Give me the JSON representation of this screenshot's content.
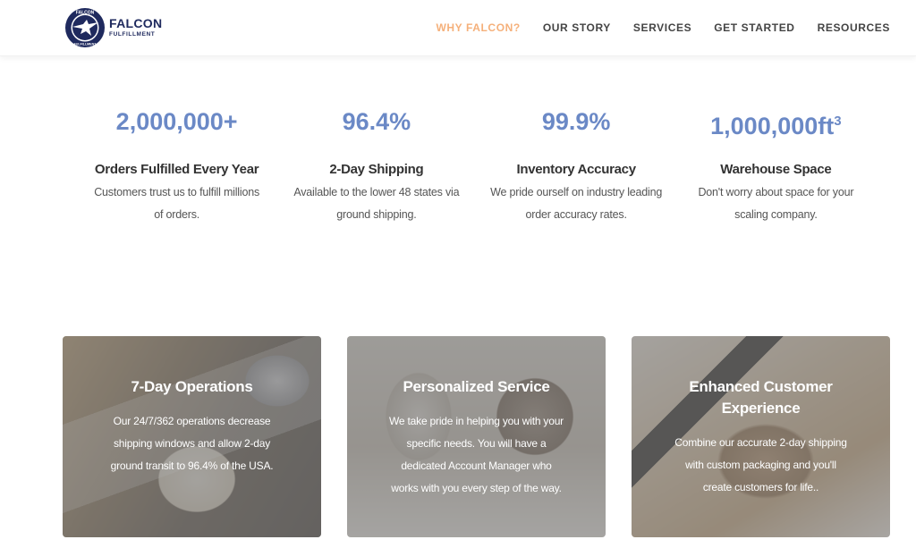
{
  "header": {
    "logo": {
      "line1": "FALCON",
      "line2": "FULFILLMENT",
      "badge_text_top": "FALCON",
      "badge_text_bottom": "FULFILLMENT"
    },
    "nav": [
      {
        "label": "WHY FALCON?",
        "active": true
      },
      {
        "label": "OUR STORY",
        "active": false
      },
      {
        "label": "SERVICES",
        "active": false
      },
      {
        "label": "GET STARTED",
        "active": false
      },
      {
        "label": "RESOURCES",
        "active": false
      }
    ]
  },
  "colors": {
    "accent": "#6b89c6",
    "nav_active": "#f5b07a",
    "brand_navy": "#1f2a5e"
  },
  "stats": [
    {
      "value": "2,000,000+",
      "sup": "",
      "title": "Orders Fulfilled Every Year",
      "desc": [
        "Customers trust us to fulfill millions",
        "of orders."
      ]
    },
    {
      "value": "96.4%",
      "sup": "",
      "title": "2-Day Shipping",
      "desc": [
        "Available to the lower 48 states via",
        "ground shipping."
      ]
    },
    {
      "value": "99.9%",
      "sup": "",
      "title": "Inventory Accuracy",
      "desc": [
        "We pride ourself on industry leading",
        "order accuracy rates."
      ]
    },
    {
      "value": "1,000,000ft",
      "sup": "3",
      "title": "Warehouse Space",
      "desc": [
        "Don't worry about space for your",
        "scaling company."
      ]
    }
  ],
  "cards": [
    {
      "title": [
        "7-Day Operations"
      ],
      "desc": [
        "Our 24/7/362 operations decrease",
        "shipping windows and allow 2-day",
        "ground transit to 96.4% of the USA."
      ]
    },
    {
      "title": [
        "Personalized Service"
      ],
      "desc": [
        "We take pride in helping you with your",
        "specific needs. You will have a",
        "dedicated Account Manager who",
        "works with you every step of the way."
      ]
    },
    {
      "title": [
        "Enhanced Customer",
        "Experience"
      ],
      "desc": [
        "Combine our accurate 2-day shipping",
        "with custom packaging and you'll",
        "create customers for life.."
      ]
    }
  ]
}
